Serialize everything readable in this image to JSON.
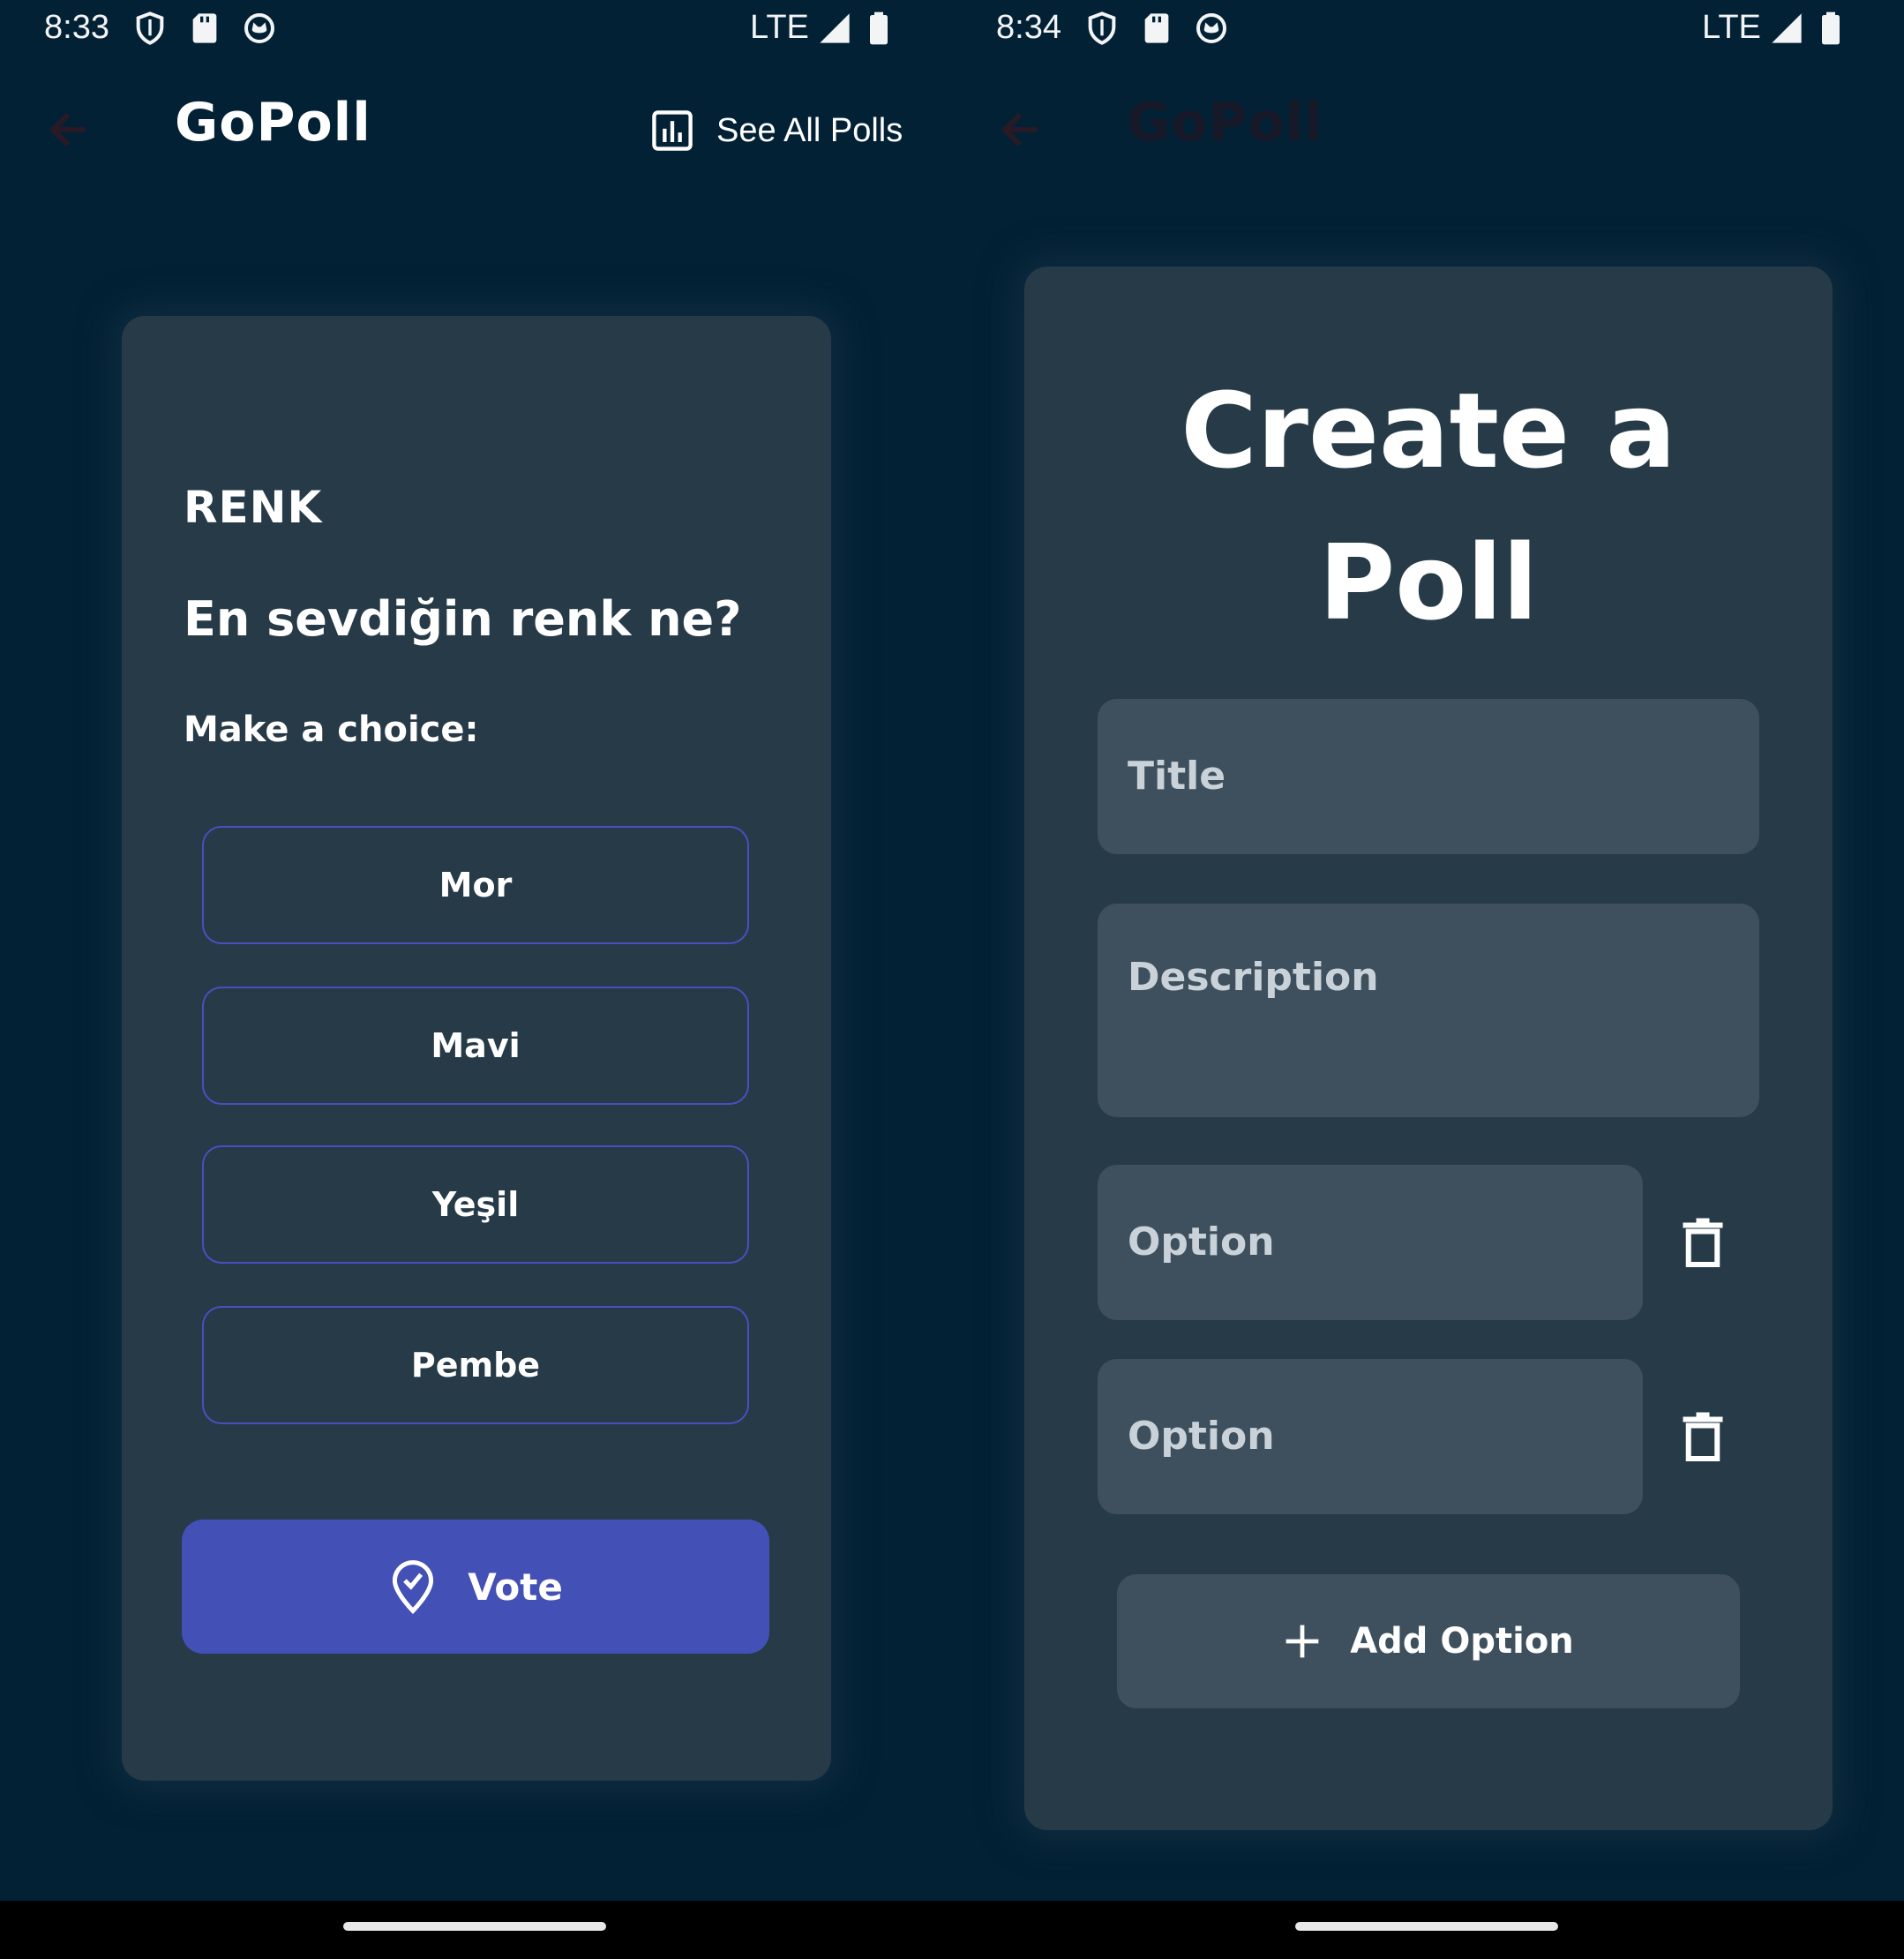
{
  "left_screen": {
    "status_bar": {
      "time": "8:33",
      "network": "LTE"
    },
    "app_bar": {
      "title": "GoPoll",
      "see_all_label": "See All Polls"
    },
    "poll": {
      "title": "RENK",
      "description": "En sevdiğin renk ne?",
      "prompt": "Make a choice:",
      "options": [
        "Mor",
        "Mavi",
        "Yeşil",
        "Pembe"
      ],
      "vote_label": "Vote"
    }
  },
  "right_screen": {
    "status_bar": {
      "time": "8:34",
      "network": "LTE"
    },
    "app_bar": {
      "title": "GoPoll"
    },
    "form": {
      "heading_line1": "Create a",
      "heading_line2": "Poll",
      "title_placeholder": "Title",
      "description_placeholder": "Description",
      "option_placeholders": [
        "Option",
        "Option"
      ],
      "add_option_label": "Add Option"
    }
  },
  "colors": {
    "background": "#032134",
    "card": "#263a47",
    "field": "#3e505e",
    "accent": "#4350b5",
    "option_border": "#4a4fc0"
  },
  "icons": {
    "status": [
      "shield-icon",
      "sd-card-icon",
      "cat-face-icon",
      "signal-icon",
      "battery-icon"
    ],
    "back": "arrow-left-icon",
    "chart": "bar-chart-icon",
    "vote": "location-check-icon",
    "delete": "trash-icon",
    "add": "plus-icon"
  }
}
